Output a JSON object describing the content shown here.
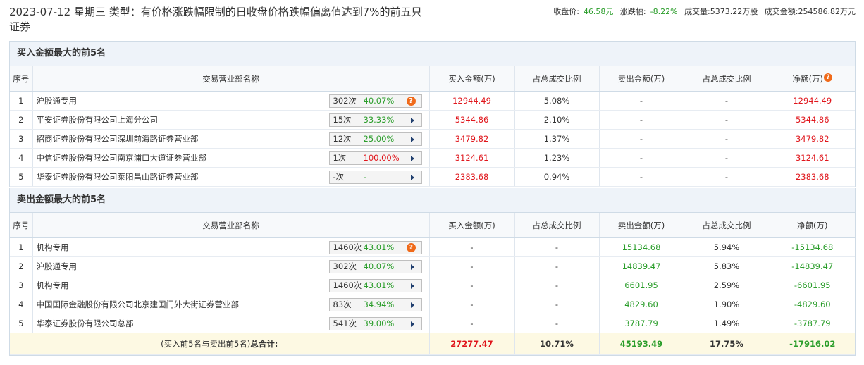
{
  "header": {
    "title": "2023-07-12 星期三 类型：有价格涨跌幅限制的日收盘价格跌幅偏离值达到7%的前五只证券",
    "close_label": "收盘价:",
    "close_value": "46.58元",
    "change_label": "涨跌幅:",
    "change_value": "-8.22%",
    "volume_label": "成交量:",
    "volume_value": "5373.22万股",
    "turnover_label": "成交金额:",
    "turnover_value": "254586.82万元"
  },
  "columns": {
    "seq": "序号",
    "name": "交易营业部名称",
    "buy": "买入金额(万)",
    "buy_ratio": "占总成交比例",
    "sell": "卖出金额(万)",
    "sell_ratio": "占总成交比例",
    "net": "净额(万)"
  },
  "buy_section": {
    "title": "买入金额最大的前5名",
    "rows": [
      {
        "seq": "1",
        "name": "沪股通专用",
        "count": "302次",
        "pct": "40.07%",
        "buy": "12944.49",
        "buy_ratio": "5.08%",
        "sell": "-",
        "sell_ratio": "-",
        "net": "12944.49"
      },
      {
        "seq": "2",
        "name": "平安证券股份有限公司上海分公司",
        "count": "15次",
        "pct": "33.33%",
        "buy": "5344.86",
        "buy_ratio": "2.10%",
        "sell": "-",
        "sell_ratio": "-",
        "net": "5344.86"
      },
      {
        "seq": "3",
        "name": "招商证券股份有限公司深圳前海路证券营业部",
        "count": "12次",
        "pct": "25.00%",
        "buy": "3479.82",
        "buy_ratio": "1.37%",
        "sell": "-",
        "sell_ratio": "-",
        "net": "3479.82"
      },
      {
        "seq": "4",
        "name": "中信证券股份有限公司南京浦口大道证券营业部",
        "count": "1次",
        "pct": "100.00%",
        "buy": "3124.61",
        "buy_ratio": "1.23%",
        "sell": "-",
        "sell_ratio": "-",
        "net": "3124.61"
      },
      {
        "seq": "5",
        "name": "华泰证券股份有限公司莱阳昌山路证券营业部",
        "count": "-次",
        "pct": "-",
        "buy": "2383.68",
        "buy_ratio": "0.94%",
        "sell": "-",
        "sell_ratio": "-",
        "net": "2383.68"
      }
    ]
  },
  "sell_section": {
    "title": "卖出金额最大的前5名",
    "rows": [
      {
        "seq": "1",
        "name": "机构专用",
        "count": "1460次",
        "pct": "43.01%",
        "buy": "-",
        "buy_ratio": "-",
        "sell": "15134.68",
        "sell_ratio": "5.94%",
        "net": "-15134.68"
      },
      {
        "seq": "2",
        "name": "沪股通专用",
        "count": "302次",
        "pct": "40.07%",
        "buy": "-",
        "buy_ratio": "-",
        "sell": "14839.47",
        "sell_ratio": "5.83%",
        "net": "-14839.47"
      },
      {
        "seq": "3",
        "name": "机构专用",
        "count": "1460次",
        "pct": "43.01%",
        "buy": "-",
        "buy_ratio": "-",
        "sell": "6601.95",
        "sell_ratio": "2.59%",
        "net": "-6601.95"
      },
      {
        "seq": "4",
        "name": "中国国际金融股份有限公司北京建国门外大街证券营业部",
        "count": "83次",
        "pct": "34.94%",
        "buy": "-",
        "buy_ratio": "-",
        "sell": "4829.60",
        "sell_ratio": "1.90%",
        "net": "-4829.60"
      },
      {
        "seq": "5",
        "name": "华泰证券股份有限公司总部",
        "count": "541次",
        "pct": "39.00%",
        "buy": "-",
        "buy_ratio": "-",
        "sell": "3787.79",
        "sell_ratio": "1.49%",
        "net": "-3787.79"
      }
    ]
  },
  "total": {
    "label_prefix": "(买入前5名与卖出前5名)",
    "label_bold": "总合计:",
    "buy": "27277.47",
    "buy_ratio": "10.71%",
    "sell": "45193.49",
    "sell_ratio": "17.75%",
    "net": "-17916.02"
  },
  "icons": {
    "help_icon": "question-mark",
    "arrow_icon": "right-triangle"
  }
}
